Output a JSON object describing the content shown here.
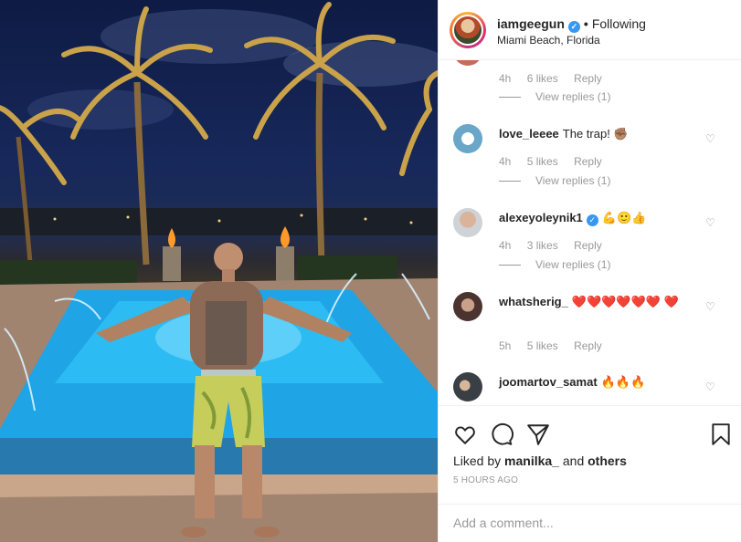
{
  "post": {
    "username": "iamgeegun",
    "follow_status": "Following",
    "location": "Miami Beach, Florida",
    "verified_icon": "verified-badge-icon"
  },
  "comments": [
    {
      "user": "",
      "text": "",
      "time": "4h",
      "likes": "6 likes",
      "reply": "Reply",
      "view_replies": "View replies (1)"
    },
    {
      "user": "love_leeee",
      "text": "The trap! ✊🏽",
      "time": "4h",
      "likes": "5 likes",
      "reply": "Reply",
      "view_replies": "View replies (1)"
    },
    {
      "user": "alexeyoleynik1",
      "text": "💪🙂👍",
      "time": "4h",
      "likes": "3 likes",
      "reply": "Reply",
      "view_replies": "View replies (1)"
    },
    {
      "user": "whatsherig_",
      "text": "❤️❤️❤️❤️❤️❤️ ❤️",
      "time": "5h",
      "likes": "5 likes",
      "reply": "Reply"
    },
    {
      "user": "joomartov_samat",
      "text": "🔥🔥🔥"
    }
  ],
  "actions": {
    "like_icon": "heart-icon",
    "comment_icon": "comment-icon",
    "share_icon": "share-icon",
    "save_icon": "bookmark-icon",
    "liked_by_prefix": "Liked by ",
    "liked_by_user": "manilka_",
    "liked_by_and": " and ",
    "liked_by_others": "others",
    "time_ago": "5 HOURS AGO"
  },
  "add_comment": {
    "placeholder": "Add a comment..."
  },
  "colors": {
    "accent_blue": "#3897f0",
    "muted": "#999999",
    "text": "#262626"
  }
}
